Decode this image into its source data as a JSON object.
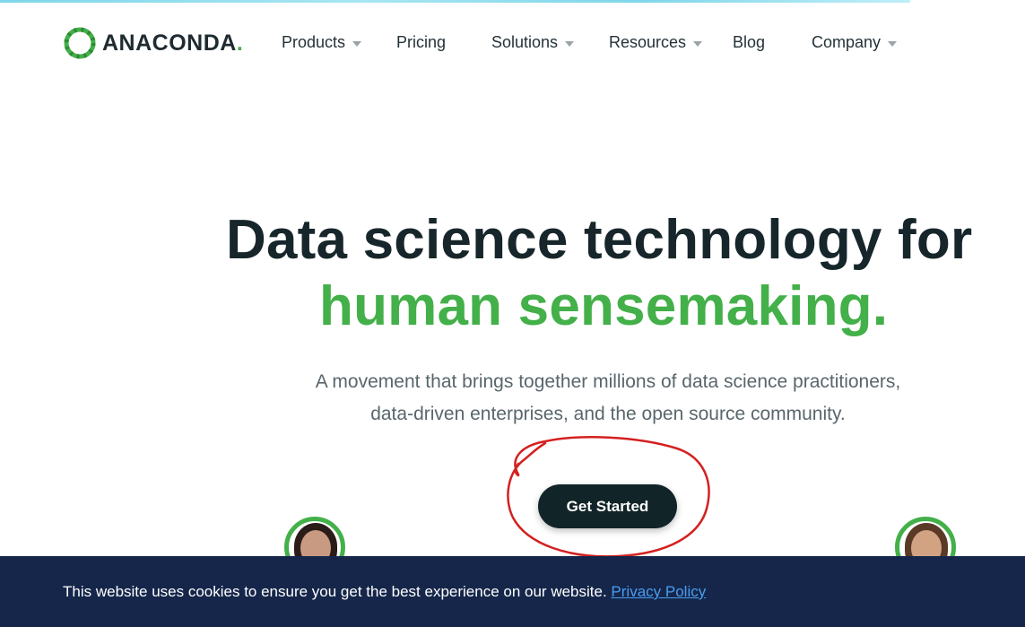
{
  "brand": {
    "name": "ANACONDA",
    "dot": ".",
    "green": "#43b049",
    "dark": "#112427"
  },
  "nav": {
    "items": [
      {
        "label": "Products",
        "dropdown": true
      },
      {
        "label": "Pricing",
        "dropdown": false
      },
      {
        "label": "Solutions",
        "dropdown": true
      },
      {
        "label": "Resources",
        "dropdown": true
      },
      {
        "label": "Blog",
        "dropdown": false
      },
      {
        "label": "Company",
        "dropdown": true
      }
    ]
  },
  "hero": {
    "headline_line1": "Data science technology for",
    "headline_line2": "human sensemaking.",
    "subtitle_line1": "A movement that brings together millions of data science practitioners,",
    "subtitle_line2": "data-driven enterprises, and the open source community.",
    "cta_label": "Get Started"
  },
  "annotation": {
    "color": "#d42020",
    "shape": "hand-drawn circle around cta"
  },
  "cookie_banner": {
    "message": "This website uses cookies to ensure you get the best experience on our website.",
    "link_label": "Privacy Policy",
    "background": "#15264a",
    "link_color": "#4a9df0"
  }
}
